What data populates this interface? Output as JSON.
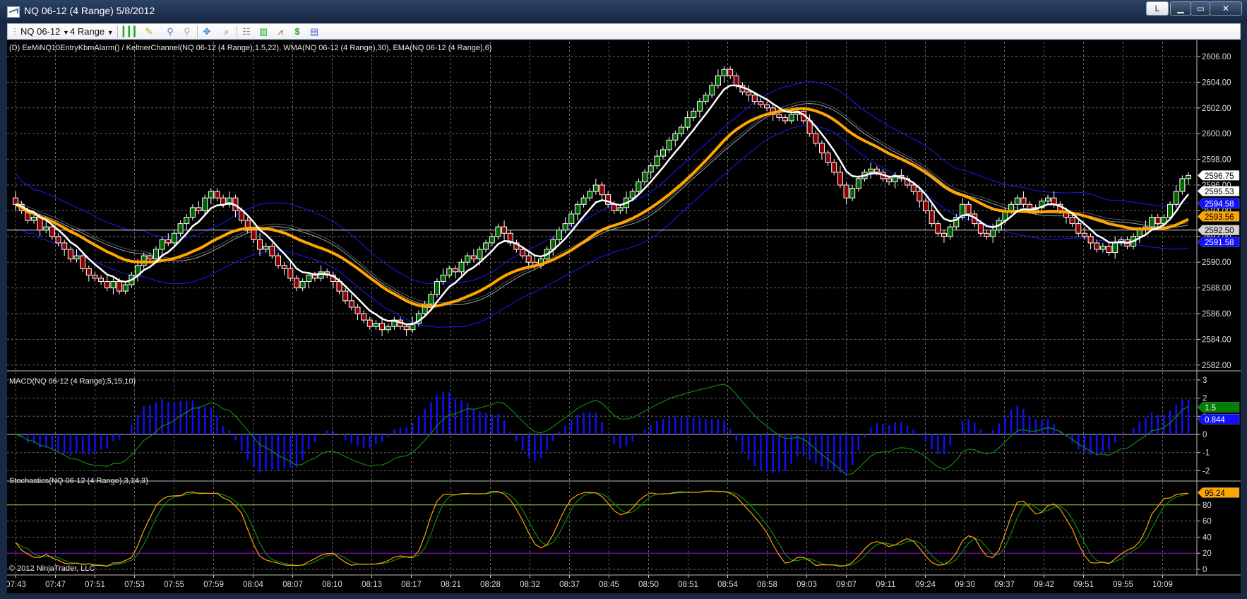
{
  "window": {
    "title": "NQ 06-12 (4 Range)  5/8/2012",
    "buttons": {
      "layout": "L",
      "minimize": "▁",
      "maximize": "▭",
      "close": "✕"
    }
  },
  "toolbar": {
    "instrument": "NQ 06-12",
    "interval": "4 Range",
    "icons": [
      "candlestick-style-icon",
      "pencil-draw-icon",
      "zoom-in-icon",
      "zoom-out-icon",
      "crosshair-icon",
      "find-icon",
      "data-box-icon",
      "chart-trader-icon",
      "strategies-icon",
      "orders-icon",
      "properties-icon"
    ]
  },
  "price_panel": {
    "label": "(D) EeMiNQ10EntryKbmAlarm() / KeltnerChannel(NQ 06-12 (4 Range),1.5,22), WMA(NQ 06-12 (4 Range),30), EMA(NQ 06-12 (4 Range),6)",
    "ticks": [
      "2606.00",
      "2604.00",
      "2602.00",
      "2600.00",
      "2598.00",
      "2596.00",
      "2594.00",
      "2592.00",
      "2590.00",
      "2588.00",
      "2586.00",
      "2584.00",
      "2582.00"
    ],
    "markers": [
      {
        "text": "2596.75",
        "value": 2596.75,
        "bg": "#ffffff",
        "fg": "#000000"
      },
      {
        "text": "2595.53",
        "value": 2595.53,
        "bg": "#ffffff",
        "fg": "#000000"
      },
      {
        "text": "2594.58",
        "value": 2594.58,
        "bg": "#1010ff",
        "fg": "#ffffff"
      },
      {
        "text": "2593.56",
        "value": 2593.56,
        "bg": "#ffa500",
        "fg": "#000000"
      },
      {
        "text": "2592.50",
        "value": 2592.5,
        "bg": "#d3d3d3",
        "fg": "#000000"
      },
      {
        "text": "2591.58",
        "value": 2591.58,
        "bg": "#1010ff",
        "fg": "#ffffff"
      }
    ],
    "horizontal_line": 2592.5
  },
  "macd_panel": {
    "label": "MACD(NQ 06-12 (4 Range),5,15,10)",
    "ticks": [
      "3",
      "2",
      "1",
      "0",
      "-1",
      "-2"
    ],
    "markers": [
      {
        "text": "1.5",
        "value": 1.5,
        "bg": "#008000",
        "fg": "#ffffff"
      },
      {
        "text": "0.844",
        "value": 0.844,
        "bg": "#1010ff",
        "fg": "#ffffff"
      }
    ]
  },
  "stoch_panel": {
    "label": "Stochastics(NQ 06-12 (4 Range),3,14,3)",
    "ticks": [
      "80",
      "60",
      "40",
      "20",
      "0"
    ],
    "markers": [
      {
        "text": "95.24",
        "value": 95.24,
        "bg": "#ffa500",
        "fg": "#000000"
      }
    ],
    "upper_line": 80,
    "lower_line": 20
  },
  "copyright": "© 2012 NinjaTrader, LLC",
  "colors": {
    "up": "#006400",
    "down": "#8b0000",
    "ema": "#ffffff",
    "wma": "#ffa500",
    "keltner": "#1a1aff",
    "keltner_mid": "#a0a0a0",
    "macd_hist": "#1010ff",
    "macd_line": "#118811",
    "stoch_k": "#ffa500",
    "stoch_d": "#118811",
    "upper": "#9acd32",
    "lower": "#9400d3"
  },
  "chart_data": {
    "type": "candlestick",
    "bar_type": "4 Range",
    "price_range": [
      2582,
      2606.6
    ],
    "x_labels": [
      "07:43",
      "07:47",
      "07:51",
      "07:53",
      "07:55",
      "07:59",
      "08:04",
      "08:07",
      "08:10",
      "08:13",
      "08:17",
      "08:21",
      "08:28",
      "08:32",
      "08:37",
      "08:45",
      "08:50",
      "08:51",
      "08:54",
      "08:58",
      "09:03",
      "09:07",
      "09:11",
      "09:24",
      "09:30",
      "09:37",
      "09:42",
      "09:51",
      "09:55",
      "10:09"
    ],
    "closes": [
      2594.5,
      2594,
      2593.25,
      2593.5,
      2592.5,
      2592.75,
      2592,
      2591.5,
      2591,
      2590.25,
      2590.5,
      2589.5,
      2589,
      2588.75,
      2588.5,
      2588,
      2588.5,
      2587.75,
      2588.25,
      2589,
      2589.75,
      2590.5,
      2590.25,
      2591,
      2591.75,
      2591.5,
      2592.25,
      2593,
      2593.5,
      2594.25,
      2594,
      2595,
      2595.5,
      2595,
      2594.5,
      2595,
      2594,
      2593.25,
      2592.5,
      2591.75,
      2591,
      2591.25,
      2590.5,
      2589.75,
      2589.5,
      2588.75,
      2588,
      2588.5,
      2589,
      2588.75,
      2589.25,
      2589,
      2588.5,
      2587.75,
      2587,
      2586.5,
      2586,
      2585.5,
      2585,
      2585.25,
      2584.75,
      2585,
      2585.5,
      2585,
      2584.75,
      2585.25,
      2586,
      2586.75,
      2587.5,
      2588.5,
      2589,
      2589.5,
      2589.25,
      2590,
      2590.5,
      2590.25,
      2591,
      2591.5,
      2592,
      2592.75,
      2592.25,
      2591.5,
      2591,
      2590.5,
      2590,
      2589.75,
      2590.25,
      2591,
      2591.75,
      2592.5,
      2593,
      2593.75,
      2594.5,
      2595,
      2595.5,
      2596,
      2595.25,
      2594.5,
      2594,
      2594.25,
      2595,
      2595.5,
      2596.25,
      2597,
      2597.5,
      2598.25,
      2598.75,
      2599.5,
      2600,
      2600.5,
      2601.25,
      2601.75,
      2602.5,
      2603,
      2603.75,
      2604.5,
      2605,
      2604.5,
      2603.75,
      2603.25,
      2603,
      2602.5,
      2602.25,
      2602,
      2601.5,
      2601.25,
      2601,
      2601.5,
      2601.75,
      2601,
      2600,
      2599.25,
      2598.5,
      2597.75,
      2597,
      2596,
      2595,
      2595.75,
      2596.5,
      2597,
      2597.25,
      2597,
      2596.5,
      2596.25,
      2596.75,
      2596.5,
      2596,
      2595.5,
      2594.75,
      2594,
      2593,
      2592.25,
      2592,
      2592.75,
      2593.5,
      2594.5,
      2593.75,
      2593,
      2592.25,
      2592,
      2592.5,
      2593.25,
      2594,
      2594.5,
      2595,
      2594.5,
      2594,
      2594.25,
      2594.75,
      2595,
      2594.5,
      2594,
      2593.5,
      2593,
      2592.25,
      2592,
      2591.5,
      2591,
      2591.25,
      2590.75,
      2591.5,
      2591.75,
      2591.25,
      2592,
      2592.5,
      2592.75,
      2593.5,
      2593,
      2593.5,
      2594.5,
      2595.5,
      2596.5,
      2596.75
    ],
    "indicators": {
      "keltner": {
        "period": 22,
        "multiplier": 1.5
      },
      "wma": {
        "period": 30
      },
      "ema": {
        "period": 6
      },
      "macd": {
        "fast": 5,
        "slow": 15,
        "smooth": 10,
        "range": [
          -2.6,
          3.3
        ]
      },
      "stochastics": {
        "d": 3,
        "k": 14,
        "smooth": 3,
        "range": [
          -5,
          100
        ]
      }
    }
  }
}
